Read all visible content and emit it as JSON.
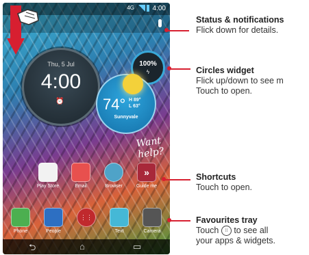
{
  "status_bar": {
    "time": "4:00",
    "data_indicator": "4G"
  },
  "clock_widget": {
    "date": "Thu, 5 Jul",
    "time": "4:00",
    "alarm_icon": "alarm-icon"
  },
  "battery_widget": {
    "percent": "100%",
    "icon": "bolt-icon"
  },
  "weather_widget": {
    "temp": "74°",
    "high": "H 89°",
    "low": "L 63°",
    "city": "Sunnyvale"
  },
  "want_help": {
    "line1": "Want",
    "line2": "help?"
  },
  "shortcuts": [
    {
      "label": "Play Store",
      "icon": "play-store-icon",
      "color": "#f2f2f2"
    },
    {
      "label": "Email",
      "icon": "email-icon",
      "color": "#e8504e"
    },
    {
      "label": "Browser",
      "icon": "browser-icon",
      "color": "#4fa3c8"
    },
    {
      "label": "Guide me",
      "icon": "guide-me-icon",
      "color": "#a8283a"
    }
  ],
  "tray": [
    {
      "label": "Phone",
      "icon": "phone-icon",
      "color": "#4caf50"
    },
    {
      "label": "People",
      "icon": "people-icon",
      "color": "#2d6fc2"
    },
    {
      "label": "",
      "icon": "apps-icon",
      "color": "#c0292d"
    },
    {
      "label": "Text",
      "icon": "text-icon",
      "color": "#45b8d6"
    },
    {
      "label": "Camera",
      "icon": "camera-icon",
      "color": "#555"
    }
  ],
  "callouts": [
    {
      "title": "Status & notifications",
      "desc": "Flick down for details."
    },
    {
      "title": "Circles widget",
      "desc1": "Flick up/down to see m",
      "desc2": "Touch to open."
    },
    {
      "title": "Shortcuts",
      "desc": "Touch to open."
    },
    {
      "title": "Favourites tray",
      "desc_pre": "Touch",
      "desc_post": "to see all",
      "desc2": "your apps & widgets."
    }
  ],
  "accent_color": "#d71f30"
}
